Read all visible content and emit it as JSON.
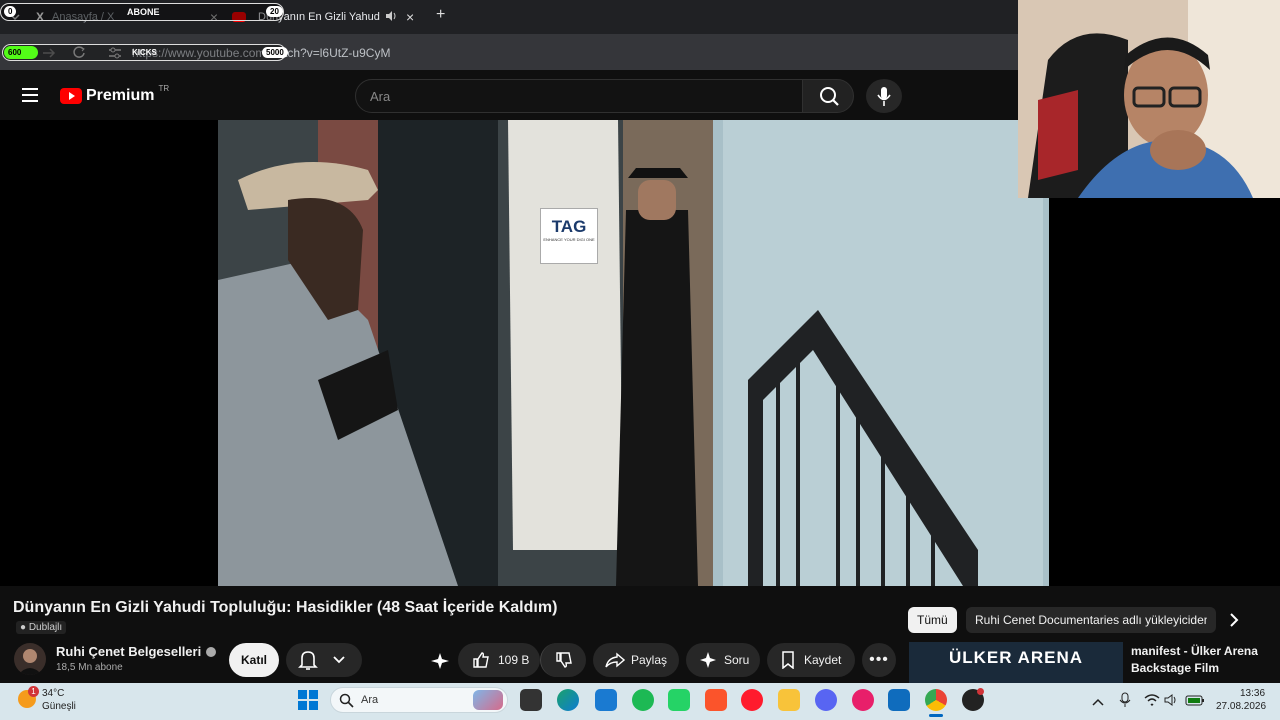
{
  "browser": {
    "tabs": [
      {
        "title": "Anasayfa / X"
      },
      {
        "title": "Dünyanın En Gizli Yahudi To"
      }
    ],
    "url": "https://www.youtube.com/watch?v=l6UtZ-u9CyM",
    "new_tab_symbol": "+",
    "close_symbol": "×"
  },
  "overlay": {
    "abone_label": "ABONE",
    "abone_count": "0",
    "kicks_label": "KICKS",
    "kicks_start": "600",
    "kicks_goal": "5000",
    "right_count": "20"
  },
  "youtube": {
    "brand": "Premium",
    "region": "TR",
    "search_placeholder": "Ara"
  },
  "video": {
    "title": "Dünyanın En Gizli Yahudi Topluluğu: Hasidikler (48 Saat İçeride Kaldım)",
    "dub_label": "Dublajlı",
    "channel_name": "Ruhi Çenet Belgeselleri",
    "subscribers": "18,5 Mn abone",
    "join_label": "Katıl",
    "likes": "109 B",
    "share_label": "Paylaş",
    "ask_label": "Soru",
    "save_label": "Kaydet",
    "sign_text": "TAG",
    "sign_subtext": "ENHANCE YOUR DIGI ONE"
  },
  "sidebar": {
    "chips": [
      {
        "label": "Tümü"
      },
      {
        "label": "Ruhi Cenet Documentaries adlı yükleyiciden"
      }
    ],
    "next_video": {
      "thumb_text": "ÜLKER ARENA",
      "title_line1": "manifest - Ülker Arena",
      "title_line2": "Backstage Film"
    }
  },
  "taskbar": {
    "weather_temp": "34°C",
    "weather_desc": "Güneşli",
    "weather_badge": "1",
    "search_label": "Ara",
    "time": "13:36",
    "date": "27.08.2026"
  },
  "colors": {
    "yt_red": "#ff0000",
    "join_bg": "#f1f1f1",
    "taskbar_bg": "#d8e6ec"
  }
}
